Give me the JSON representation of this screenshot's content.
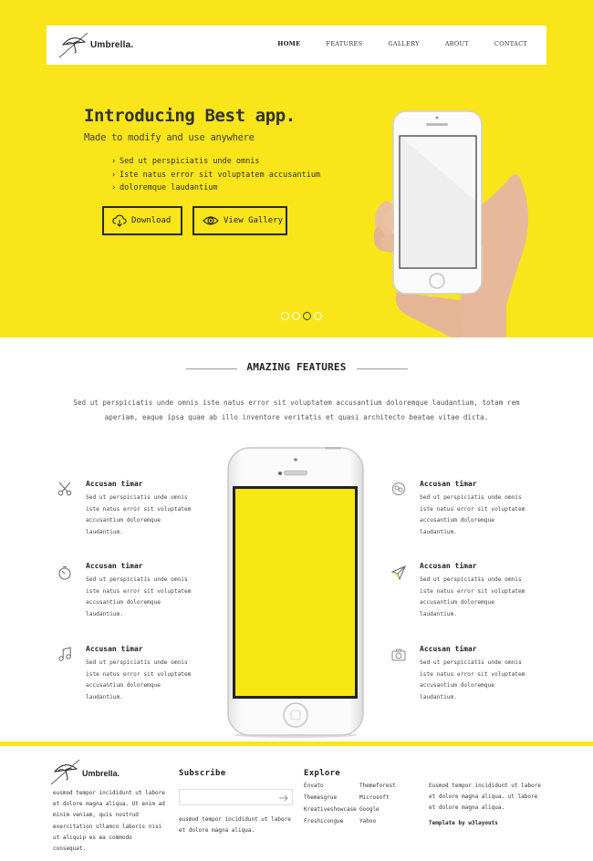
{
  "brand": {
    "name": "Umbrella."
  },
  "nav": {
    "items": [
      {
        "label": "HOME",
        "active": true
      },
      {
        "label": "FEATURES",
        "active": false
      },
      {
        "label": "GALLERY",
        "active": false
      },
      {
        "label": "ABOUT",
        "active": false
      },
      {
        "label": "CONTACT",
        "active": false
      }
    ]
  },
  "hero": {
    "title": "Introducing Best app.",
    "subtitle": "Made to modify and use anywhere",
    "bullets": [
      "Sed ut perspiciatis unde omnis",
      "Iste natus error sit voluptatem accusantium",
      "doloremque laudantium"
    ],
    "download_label": "Download",
    "gallery_label": "View Gallery",
    "slides_count": 4,
    "active_slide": 3,
    "background_color": "#f9e51a"
  },
  "features": {
    "title": "AMAZING FEATURES",
    "description": "Sed ut perspiciatis unde omnis iste natus error sit voluptatem accusantium doloremque laudantium, totam rem aperiam, eaque ipsa quae ab illo inventore veritatis et quasi architecto beatae vitae dicta.",
    "items": [
      {
        "icon": "scissors-icon",
        "title": "Accusan timar",
        "text": "Sed ut perspiciatis unde omnis iste natus error sit voluptatem accusantium doloremque laudantium."
      },
      {
        "icon": "timer-icon",
        "title": "Accusan timar",
        "text": "Sed ut perspiciatis unde omnis iste natus error sit voluptatem accusantium doloremque laudantium."
      },
      {
        "icon": "music-note-icon",
        "title": "Accusan timar",
        "text": "Sed ut perspiciatis unde omnis iste natus error sit voluptatem accusantium doloremque laudantium."
      },
      {
        "icon": "chat-icon",
        "title": "Accusan timar",
        "text": "Sed ut perspiciatis unde omnis iste natus error sit voluptatem accusantium doloremque laudantium."
      },
      {
        "icon": "paper-plane-icon",
        "title": "Accusan timar",
        "text": "Sed ut perspiciatis unde omnis iste natus error sit voluptatem accusantium doloremque laudantium."
      },
      {
        "icon": "camera-icon",
        "title": "Accusan timar",
        "text": "Sed ut perspiciatis unde omnis iste natus error sit voluptatem accusantium doloremque laudantium."
      }
    ]
  },
  "footer": {
    "about_text": "eusmod tempor incididunt ut labore et dolore magna aliqua. Ut enim ad minim veniam, quis nostrud exercitation ullamco laboris nisi ut aliquip ex ea commodo consequat.",
    "subscribe_title": "Subscribe",
    "subscribe_text": "eusmod tempor incididunt ut labore et dolore magna aliqua.",
    "explore_title": "Explore",
    "explore_links": [
      "Envato",
      "Themeforest",
      "Themesgrue",
      "Microsoft",
      "Kreativeshowcase",
      "Google",
      "Freshicongue",
      "Yahoo"
    ],
    "right_text": "Eusmod tempor incididunt ut labore et dolore magna aliqua. ut labore et dolore magna aliqua.",
    "credit": "Template by w3layouts"
  }
}
